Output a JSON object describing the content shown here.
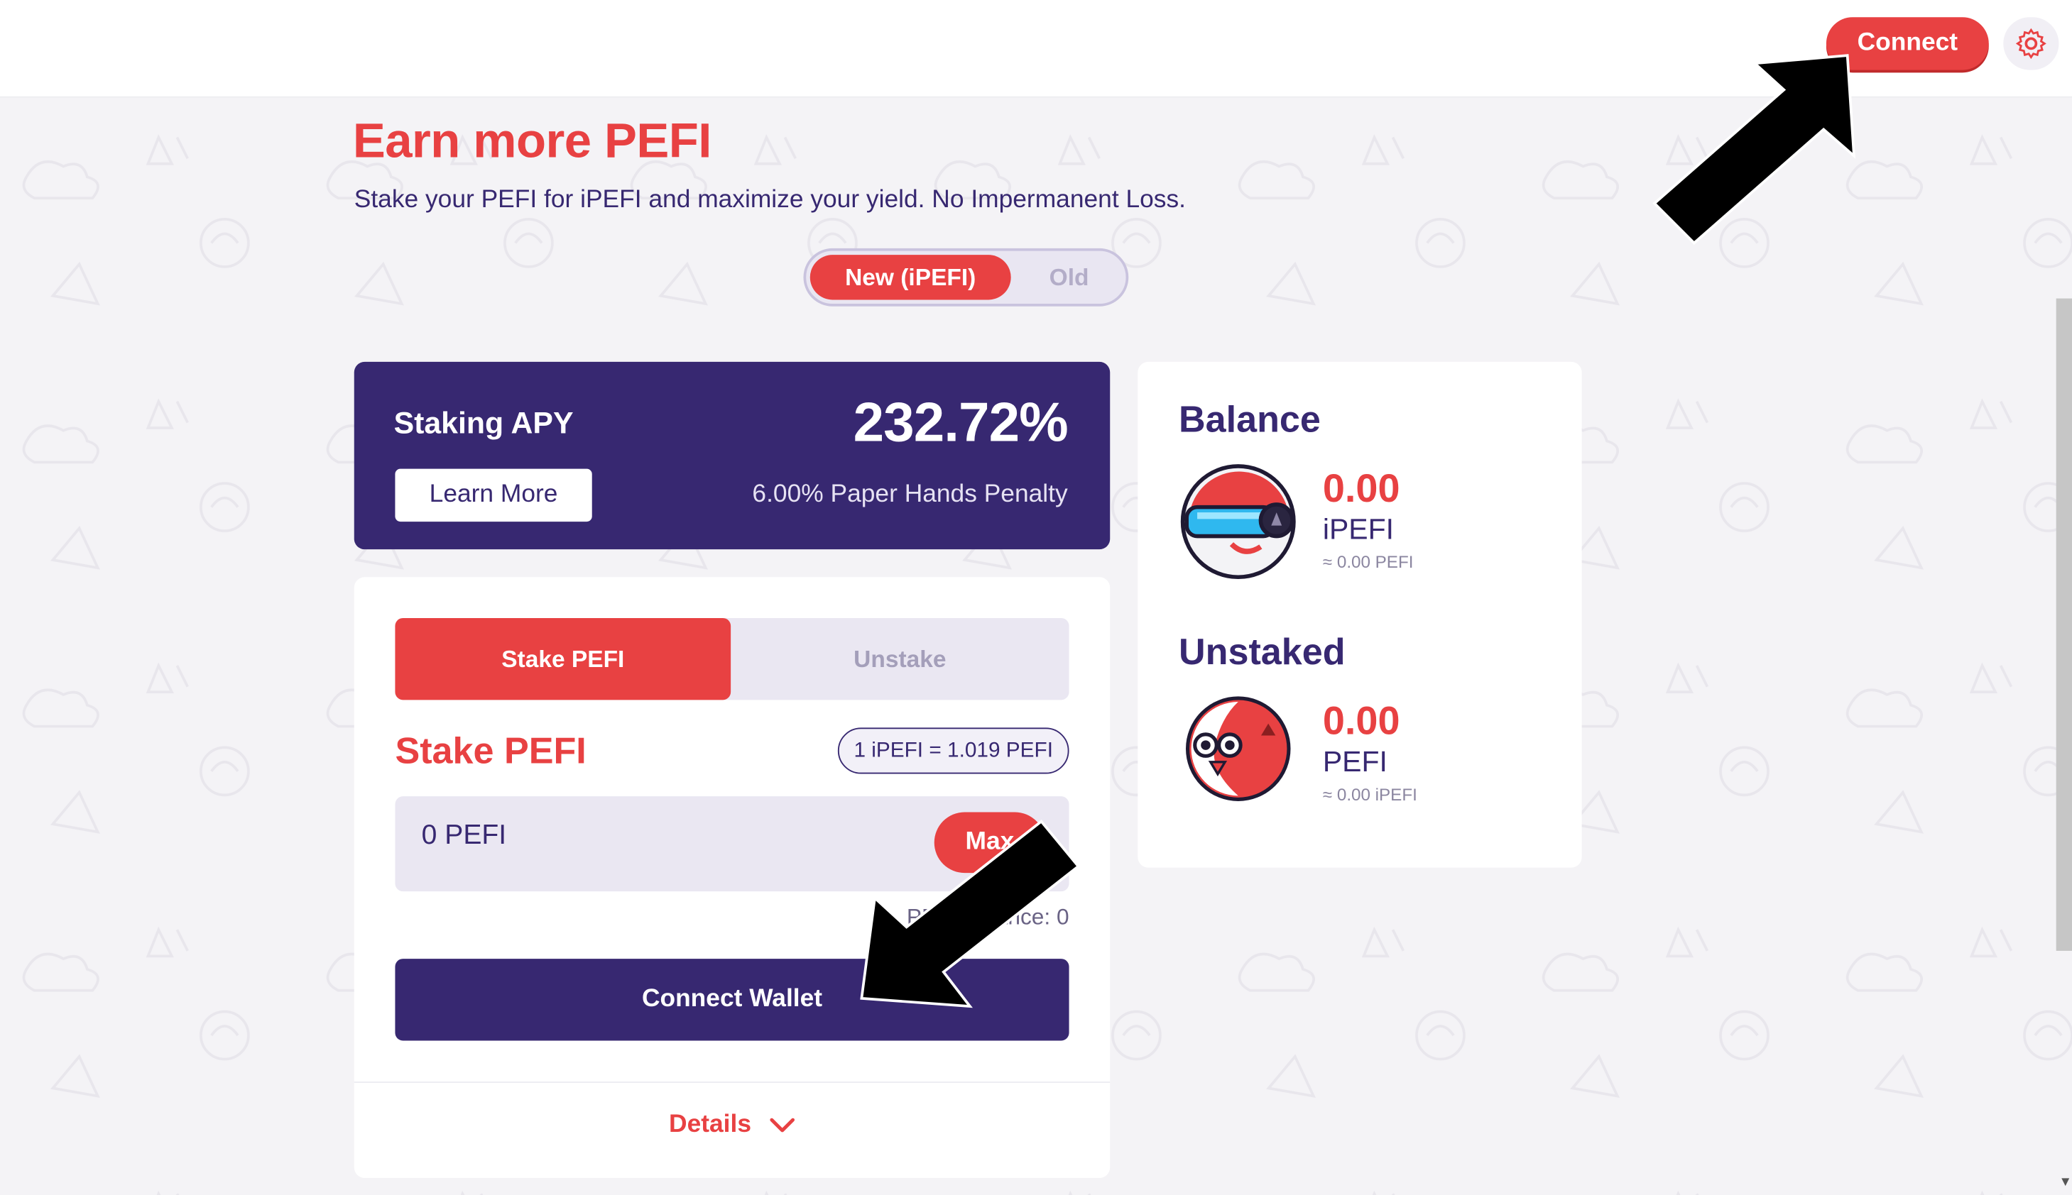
{
  "header": {
    "connect_label": "Connect",
    "settings_icon": "gear-icon"
  },
  "page": {
    "title": "Earn more PEFI",
    "subtitle": "Stake your PEFI for iPEFI and maximize your yield. No Impermanent Loss."
  },
  "version_toggle": {
    "new_label": "New (iPEFI)",
    "old_label": "Old",
    "selected": "New (iPEFI)"
  },
  "apy_card": {
    "label": "Staking APY",
    "value": "232.72%",
    "learn_more_label": "Learn More",
    "penalty": "6.00% Paper Hands Penalty"
  },
  "stake_card": {
    "tabs": [
      {
        "label": "Stake PEFI",
        "active": true
      },
      {
        "label": "Unstake",
        "active": false
      }
    ],
    "heading": "Stake PEFI",
    "rate": "1 iPEFI = 1.019 PEFI",
    "amount_value": "0 PEFI",
    "max_label": "Max",
    "balance_text": "PEFI Balance: 0",
    "connect_wallet_label": "Connect Wallet",
    "details_label": "Details"
  },
  "balance_card": {
    "balance_heading": "Balance",
    "balance_amount": "0.00",
    "balance_token": "iPEFI",
    "balance_approx": "≈ 0.00 PEFI",
    "unstaked_heading": "Unstaked",
    "unstaked_amount": "0.00",
    "unstaked_token": "PEFI",
    "unstaked_approx": "≈ 0.00 iPEFI"
  },
  "colors": {
    "accent_red": "#e84142",
    "brand_purple": "#372871",
    "background": "#f4f3f6"
  }
}
